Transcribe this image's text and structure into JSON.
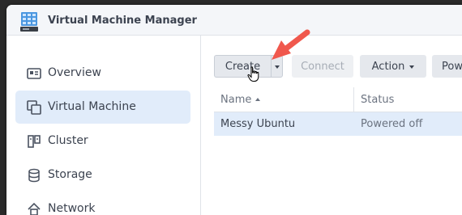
{
  "window": {
    "title": "Virtual Machine Manager",
    "app_icon": "vmm-app-icon"
  },
  "sidebar": {
    "items": [
      {
        "label": "Overview",
        "icon": "overview-icon",
        "active": false
      },
      {
        "label": "Virtual Machine",
        "icon": "virtual-machine-icon",
        "active": true
      },
      {
        "label": "Cluster",
        "icon": "cluster-icon",
        "active": false
      },
      {
        "label": "Storage",
        "icon": "storage-icon",
        "active": false
      },
      {
        "label": "Network",
        "icon": "network-icon",
        "active": false
      }
    ]
  },
  "toolbar": {
    "create_label": "Create",
    "connect_label": "Connect",
    "action_label": "Action",
    "power_label": "Pow"
  },
  "table": {
    "columns": [
      "Name",
      "Status"
    ],
    "rows": [
      {
        "name": "Messy Ubuntu",
        "status": "Powered off"
      }
    ]
  },
  "colors": {
    "accent_selected": "#e1ecfa",
    "annotation_arrow": "#f0584d"
  }
}
